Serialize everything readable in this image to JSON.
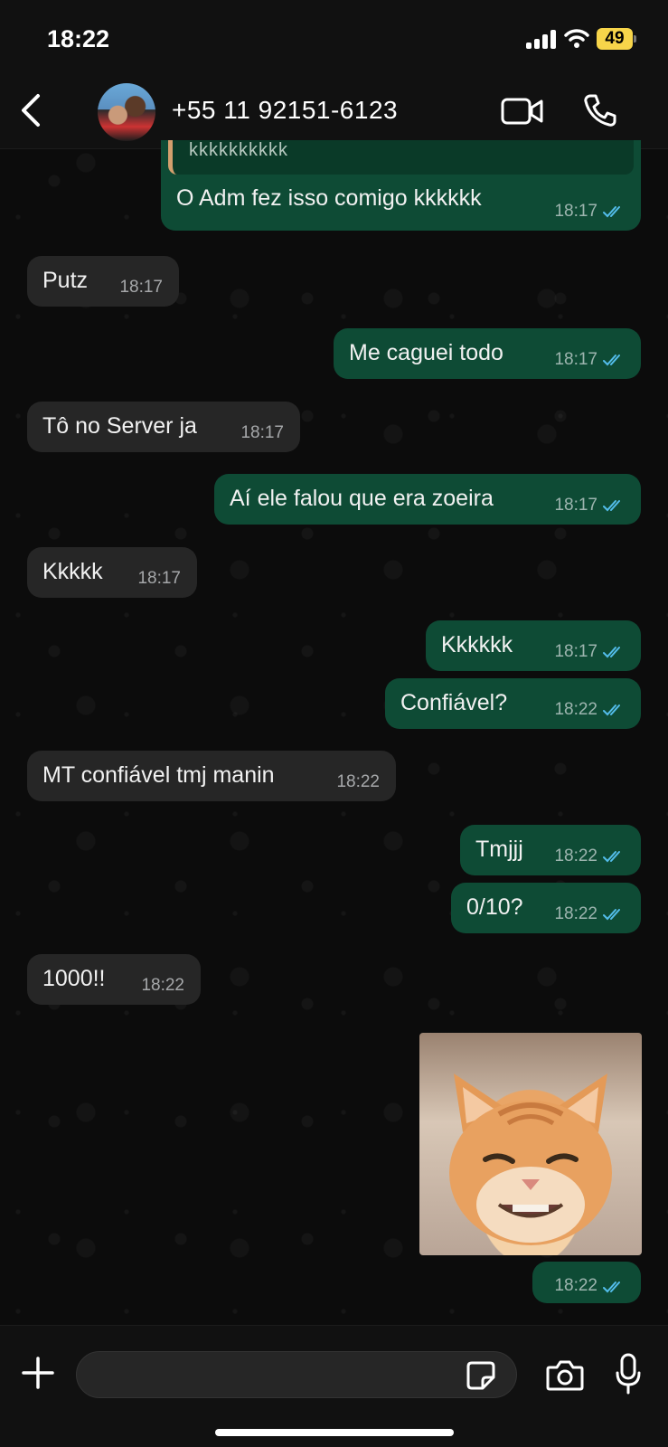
{
  "status_bar": {
    "time": "18:22",
    "battery": "49",
    "icons": [
      "signal-icon",
      "wifi-icon",
      "battery-icon"
    ]
  },
  "header": {
    "contact": "+55 11 92151-6123",
    "icons": [
      "back-icon",
      "avatar",
      "video-call-icon",
      "voice-call-icon"
    ]
  },
  "messages": [
    {
      "dir": "out",
      "quote": "kkkkkkkkkk",
      "text": "O Adm fez isso comigo kkkkkk",
      "time": "18:17",
      "read": true
    },
    {
      "dir": "in",
      "text": "Putz",
      "time": "18:17"
    },
    {
      "dir": "out",
      "text": "Me caguei todo",
      "time": "18:17",
      "read": true
    },
    {
      "dir": "in",
      "text": "Tô no Server ja",
      "time": "18:17"
    },
    {
      "dir": "out",
      "text": "Aí ele falou que era zoeira",
      "time": "18:17",
      "read": true
    },
    {
      "dir": "in",
      "text": "Kkkkk",
      "time": "18:17"
    },
    {
      "dir": "out",
      "text": "Kkkkkk",
      "time": "18:17",
      "read": true
    },
    {
      "dir": "out",
      "text": "Confiável?",
      "time": "18:22",
      "read": true
    },
    {
      "dir": "in",
      "text": "MT confiável tmj manin",
      "time": "18:22"
    },
    {
      "dir": "out",
      "text": "Tmjjj",
      "time": "18:22",
      "read": true
    },
    {
      "dir": "out",
      "text": "0/10?",
      "time": "18:22",
      "read": true
    },
    {
      "dir": "in",
      "text": "1000!!",
      "time": "18:22"
    },
    {
      "dir": "out",
      "type": "image",
      "image": "smiling-cat-photo",
      "time": "18:22",
      "read": true
    }
  ],
  "input_bar": {
    "placeholder": "",
    "icons": [
      "plus-icon",
      "sticker-icon",
      "camera-icon",
      "microphone-icon"
    ]
  },
  "colors": {
    "incoming_bubble": "#262626",
    "outgoing_bubble": "#0e4b35",
    "read_ticks": "#53bdeb",
    "battery": "#f7d54a"
  }
}
